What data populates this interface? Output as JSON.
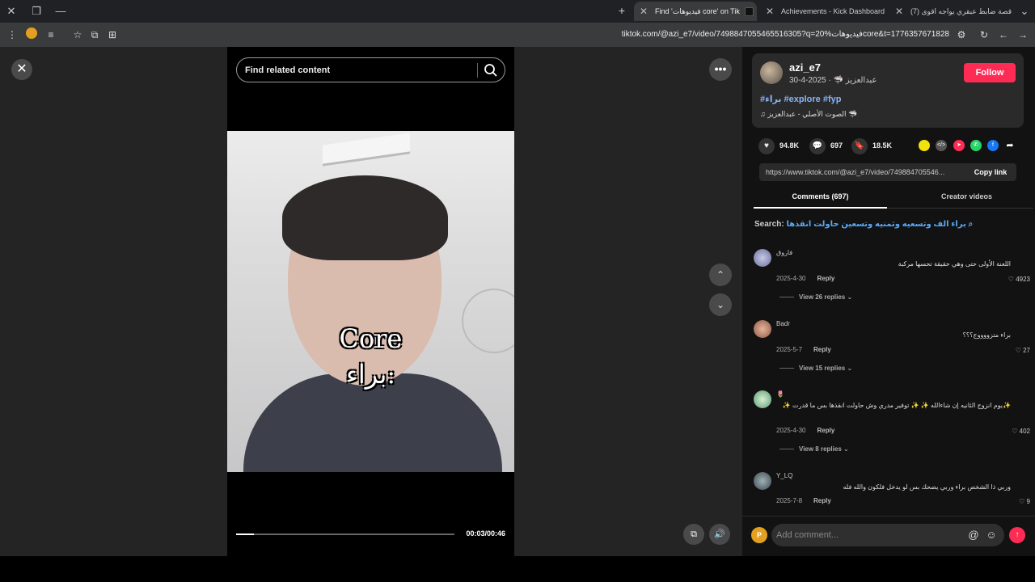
{
  "browser": {
    "tabs": [
      {
        "title": "Find 'فيديوهات core' on Tik",
        "active": true
      },
      {
        "title": "Achievements - Kick Dashboard",
        "active": false
      },
      {
        "title": "(7) قصة ضابط عبقري يواجه اقوى",
        "active": false
      }
    ],
    "url": "tiktok.com/@azi_e7/video/7498847055465516305?q=فيديوهات%20core&t=1776357671828"
  },
  "video": {
    "search_placeholder": "Find related content",
    "caption_line1": "Core",
    "caption_line2": "براء:",
    "time": "00:03/00:46",
    "progress_fraction": 0.08
  },
  "author": {
    "username": "azi_e7",
    "nickname": "عبدالعزيز 🦈",
    "date": "2025-4-30",
    "follow_label": "Follow",
    "tags": "#براء #explore #fyp",
    "music": "الصوت الأصلي - عبدالعزيز 🦈"
  },
  "stats": {
    "likes": "94.8K",
    "comments": "697",
    "saves": "18.5K"
  },
  "share": {
    "link": "https://www.tiktok.com/@azi_e7/video/749884705546...",
    "copy_label": "Copy link"
  },
  "panel_tabs": {
    "comments": "Comments (697)",
    "creator": "Creator videos"
  },
  "comment_search": {
    "label": "Search:",
    "query": "براء الف وتسعيه وثمنيه وتسعين حاولت انقذها"
  },
  "comments": [
    {
      "name": "فاروق",
      "text": "اللعنة الأولى حتى وهي حقيقة تحسها مركبة",
      "date": "2025-4-30",
      "reply": "Reply",
      "likes": "4923",
      "view_replies": "View 26 replies"
    },
    {
      "name": "Badr",
      "text": "براء متزووووج؟؟؟",
      "date": "2025-5-7",
      "reply": "Reply",
      "likes": "27",
      "view_replies": "View 15 replies"
    },
    {
      "name": "🌷",
      "text": "✨يوم انزوج الثانيه إن شاءالله ✨ ✨ توفير مدري وش حاولت انقذها بس ما قدرت ✨",
      "date": "2025-4-30",
      "reply": "Reply",
      "likes": "402",
      "view_replies": "View 8 replies"
    },
    {
      "name": "Y_LQ",
      "text": "وربي ذا الشخص براء وربي يضحك بس لو يدخل فلكون والله فله",
      "date": "2025-7-8",
      "reply": "Reply",
      "likes": "9",
      "view_replies": ""
    }
  ],
  "compose": {
    "placeholder": "Add comment...",
    "avatar_letter": "P"
  },
  "colors": {
    "accent": "#fe2c55",
    "link": "#8ab4f8"
  }
}
